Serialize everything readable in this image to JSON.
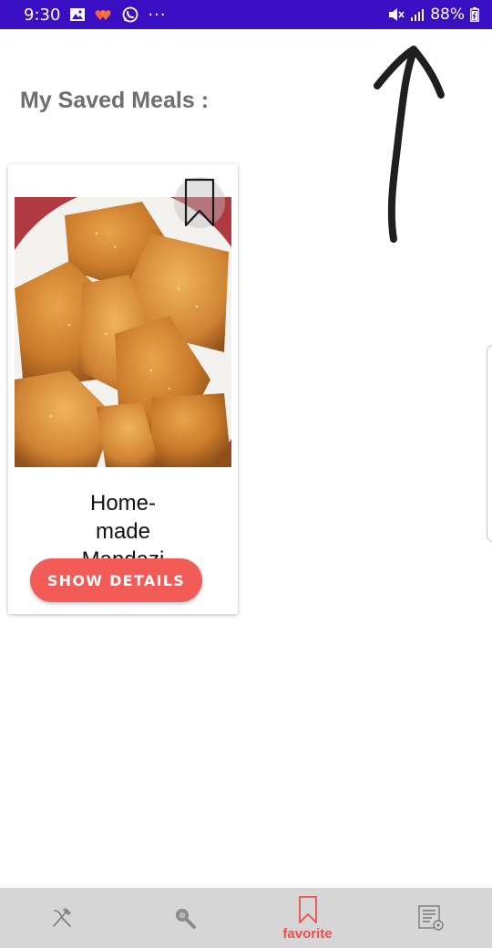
{
  "status_bar": {
    "time": "9:30",
    "battery": "88%",
    "more_glyph": "···",
    "background": "#3a0fc4",
    "icons": [
      "gallery-icon",
      "hearts-icon",
      "whatsapp-icon",
      "more-icon",
      "mute-icon",
      "signal-icon",
      "battery-icon"
    ]
  },
  "page": {
    "title": "My Saved Meals :"
  },
  "saved_meals": [
    {
      "name": "Home-made Mandazi",
      "button_label": "SHOW DETAILS",
      "bookmarked": true,
      "image_icon": "mandazi-photo"
    }
  ],
  "bottom_nav": {
    "items": [
      {
        "icon": "cutlery-icon",
        "label": ""
      },
      {
        "icon": "search-icon",
        "label": ""
      },
      {
        "icon": "bookmark-icon",
        "label": "favorite",
        "active": true
      },
      {
        "icon": "recipe-list-icon",
        "label": ""
      }
    ],
    "active_color": "#ee4f4b"
  },
  "colors": {
    "accent": "#f35b57",
    "title_gray": "#6e6e6e"
  }
}
